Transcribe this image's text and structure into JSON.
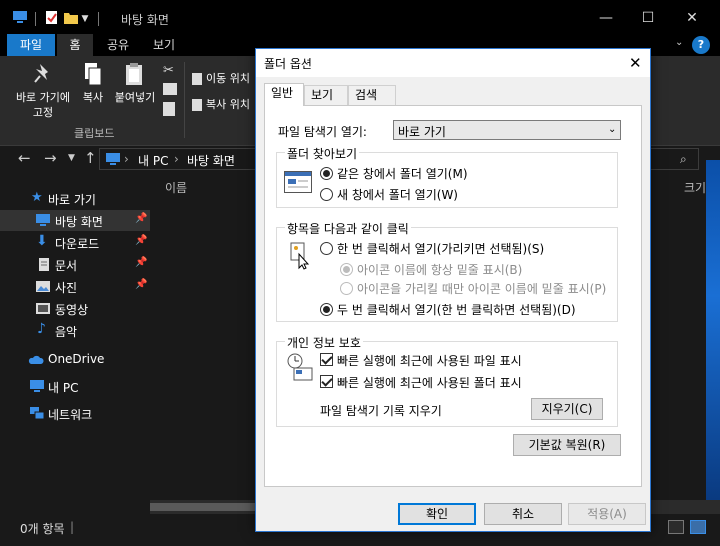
{
  "explorer": {
    "title": "바탕 화면",
    "ribbon_tabs": [
      "파일",
      "홈",
      "공유",
      "보기"
    ],
    "ribbon": {
      "pin_label_1": "바로 가기에",
      "pin_label_2": "고정",
      "copy_label": "복사",
      "paste_label": "붙여넣기",
      "group_label": "클립보드",
      "move_to": "이동 위치",
      "copy_to": "복사 위치"
    },
    "address": {
      "path_1": "내 PC",
      "path_2": "바탕 화면"
    },
    "sidebar": {
      "items": [
        {
          "label": "바로 가기"
        },
        {
          "label": "바탕 화면"
        },
        {
          "label": "다운로드"
        },
        {
          "label": "문서"
        },
        {
          "label": "사진"
        },
        {
          "label": "동영상"
        },
        {
          "label": "음악"
        },
        {
          "label": "OneDrive"
        },
        {
          "label": "내 PC"
        },
        {
          "label": "네트워크"
        }
      ]
    },
    "columns": {
      "name": "이름",
      "size": "크기"
    },
    "status": "0개 항목"
  },
  "dialog": {
    "title": "폴더 옵션",
    "tabs": [
      "일반",
      "보기",
      "검색"
    ],
    "explorer_open_label": "파일 탐색기 열기:",
    "explorer_open_value": "바로 가기",
    "browse_group": {
      "title": "폴더 찾아보기",
      "same_window": "같은 창에서 폴더 열기(M)",
      "new_window": "새 창에서 폴더 열기(W)"
    },
    "click_group": {
      "title": "항목을 다음과 같이 클릭",
      "single_click": "한 번 클릭해서 열기(가리키면 선택됨)(S)",
      "underline_always": "아이콘 이름에 항상 밑줄 표시(B)",
      "underline_point": "아이콘을 가리킬 때만 아이콘 이름에 밑줄 표시(P)",
      "double_click": "두 번 클릭해서 열기(한 번 클릭하면 선택됨)(D)"
    },
    "privacy_group": {
      "title": "개인 정보 보호",
      "recent_files": "빠른 실행에 최근에 사용된 파일 표시",
      "recent_folders": "빠른 실행에 최근에 사용된 폴더 표시",
      "clear_label": "파일 탐색기 기록 지우기",
      "clear_button": "지우기(C)"
    },
    "restore_button": "기본값 복원(R)",
    "ok_button": "확인",
    "cancel_button": "취소",
    "apply_button": "적용(A)"
  },
  "colors": {
    "accent": "#1979ca",
    "dark_bg": "#191919",
    "dialog_bg": "#f0f0f0"
  }
}
